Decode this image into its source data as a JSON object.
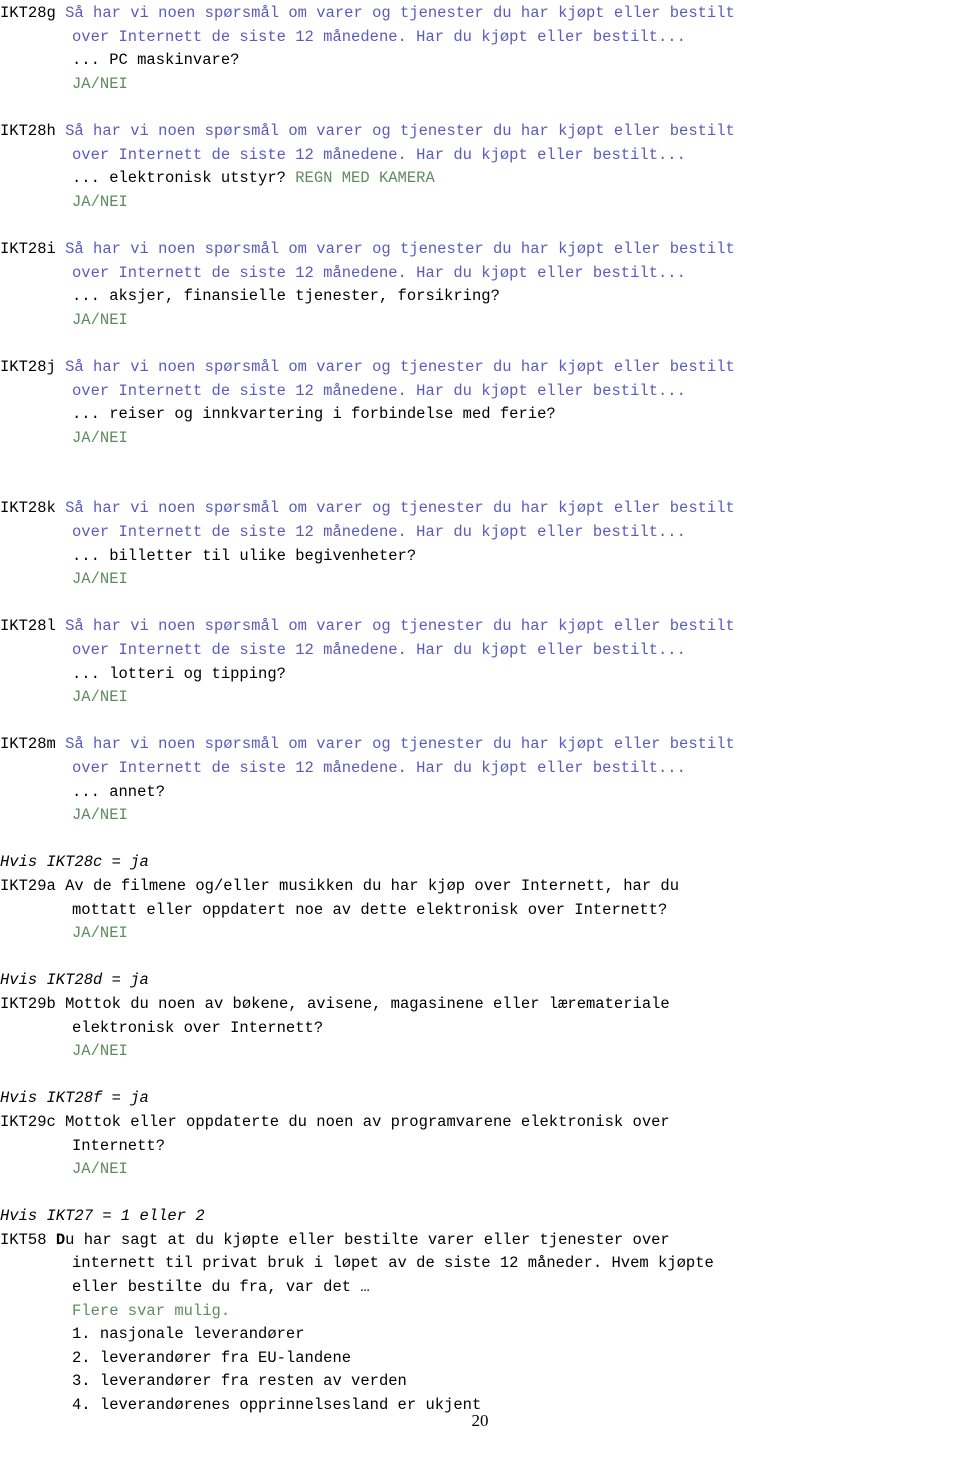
{
  "document": {
    "page_number": "20",
    "colors": {
      "question_text": "#5b5bbd",
      "instruction_green": "#5d8c5d",
      "body_black": "#000000"
    }
  },
  "blocks": [
    {
      "code": "IKT28g",
      "intro_line1": "Så har vi noen spørsmål om varer og tjenester du har kjøpt eller bestilt",
      "intro_line2": "over Internett de siste 12 månedene. Har du kjøpt eller bestilt...",
      "item": "... PC maskinvare?",
      "note": "",
      "answer": "JA/NEI"
    },
    {
      "code": "IKT28h",
      "intro_line1": "Så har vi noen spørsmål om varer og tjenester du har kjøpt eller bestilt",
      "intro_line2": "over Internett de siste 12 månedene. Har du kjøpt eller bestilt...",
      "item": "... elektronisk utstyr?",
      "note": "REGN MED KAMERA",
      "answer": "JA/NEI"
    },
    {
      "code": "IKT28i",
      "intro_line1": "Så har vi noen spørsmål om varer og tjenester du har kjøpt eller bestilt",
      "intro_line2": "over Internett de siste 12 månedene. Har du kjøpt eller bestilt...",
      "item": "... aksjer, finansielle tjenester, forsikring?",
      "note": "",
      "answer": "JA/NEI"
    },
    {
      "code": "IKT28j",
      "intro_line1": "Så har vi noen spørsmål om varer og tjenester du har kjøpt eller bestilt",
      "intro_line2": "over Internett de siste 12 månedene. Har du kjøpt eller bestilt...",
      "item": "... reiser og innkvartering i forbindelse med ferie?",
      "note": "",
      "answer": "JA/NEI"
    },
    {
      "code": "IKT28k",
      "intro_line1": "Så har vi noen spørsmål om varer og tjenester du har kjøpt eller bestilt",
      "intro_line2": "over Internett de siste 12 månedene. Har du kjøpt eller bestilt...",
      "item": "... billetter til ulike begivenheter?",
      "note": "",
      "answer": "JA/NEI"
    },
    {
      "code": "IKT28l",
      "intro_line1": "Så har vi noen spørsmål om varer og tjenester du har kjøpt eller bestilt",
      "intro_line2": "over Internett de siste 12 månedene. Har du kjøpt eller bestilt...",
      "item": "... lotteri og tipping?",
      "note": "",
      "answer": "JA/NEI"
    },
    {
      "code": "IKT28m",
      "intro_line1": "Så har vi noen spørsmål om varer og tjenester du har kjøpt eller bestilt",
      "intro_line2": "over Internett de siste 12 månedene. Har du kjøpt eller bestilt...",
      "item": "... annet?",
      "note": "",
      "answer": "JA/NEI"
    }
  ],
  "followups": [
    {
      "condition": "Hvis IKT28c = ja",
      "code": "IKT29a",
      "line1": "Av de filmene og/eller musikken du har kjøp over Internett, har du",
      "line2": "mottatt eller oppdatert noe av dette elektronisk over Internett?",
      "answer": "JA/NEI"
    },
    {
      "condition": "Hvis IKT28d = ja",
      "code": "IKT29b",
      "line1": "Mottok du noen av bøkene, avisene, magasinene eller læremateriale",
      "line2": "elektronisk over Internett?",
      "answer": "JA/NEI"
    },
    {
      "condition": "Hvis IKT28f = ja",
      "code": "IKT29c",
      "line1": "Mottok eller oppdaterte du noen av programvarene elektronisk over",
      "line2": "Internett?",
      "answer": "JA/NEI"
    }
  ],
  "final": {
    "condition": "Hvis IKT27 = 1 eller 2",
    "code": "IKT58",
    "bold_initial": "D",
    "line1_rest": "u har sagt at du kjøpte eller bestilte varer eller tjenester over",
    "line2": "internett til privat bruk i løpet av de siste 12 måneder. Hvem kjøpte",
    "line3": "eller bestilte du fra, var det …",
    "multi_note": "Flere svar mulig.",
    "options": [
      "1. nasjonale leverandører",
      "2. leverandører fra EU-landene",
      "3. leverandører fra resten av verden",
      "4. leverandørenes opprinnelsesland er ukjent"
    ]
  }
}
